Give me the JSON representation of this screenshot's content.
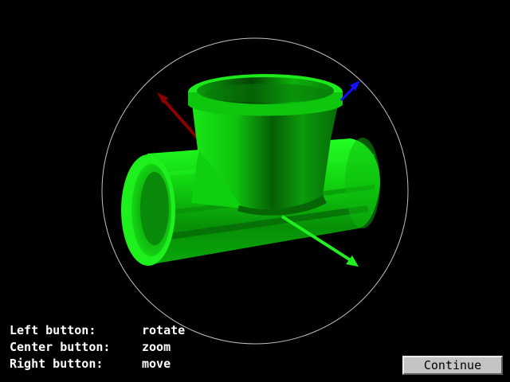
{
  "help": {
    "rows": [
      {
        "key": "Left button:",
        "action": "rotate"
      },
      {
        "key": "Center button:",
        "action": "zoom"
      },
      {
        "key": "Right button:",
        "action": "move"
      }
    ]
  },
  "buttons": {
    "continue_label": "Continue"
  },
  "colors": {
    "background": "#000000",
    "model": "#00cc00",
    "axis_x": "#8b0000",
    "axis_y": "#22ee22",
    "axis_z": "#1010ff",
    "trackball_circle": "#c0c0c0",
    "text": "#ffffff"
  },
  "scene": {
    "model_icon": "pipe-tee-icon",
    "trackball": "trackball-circle"
  }
}
